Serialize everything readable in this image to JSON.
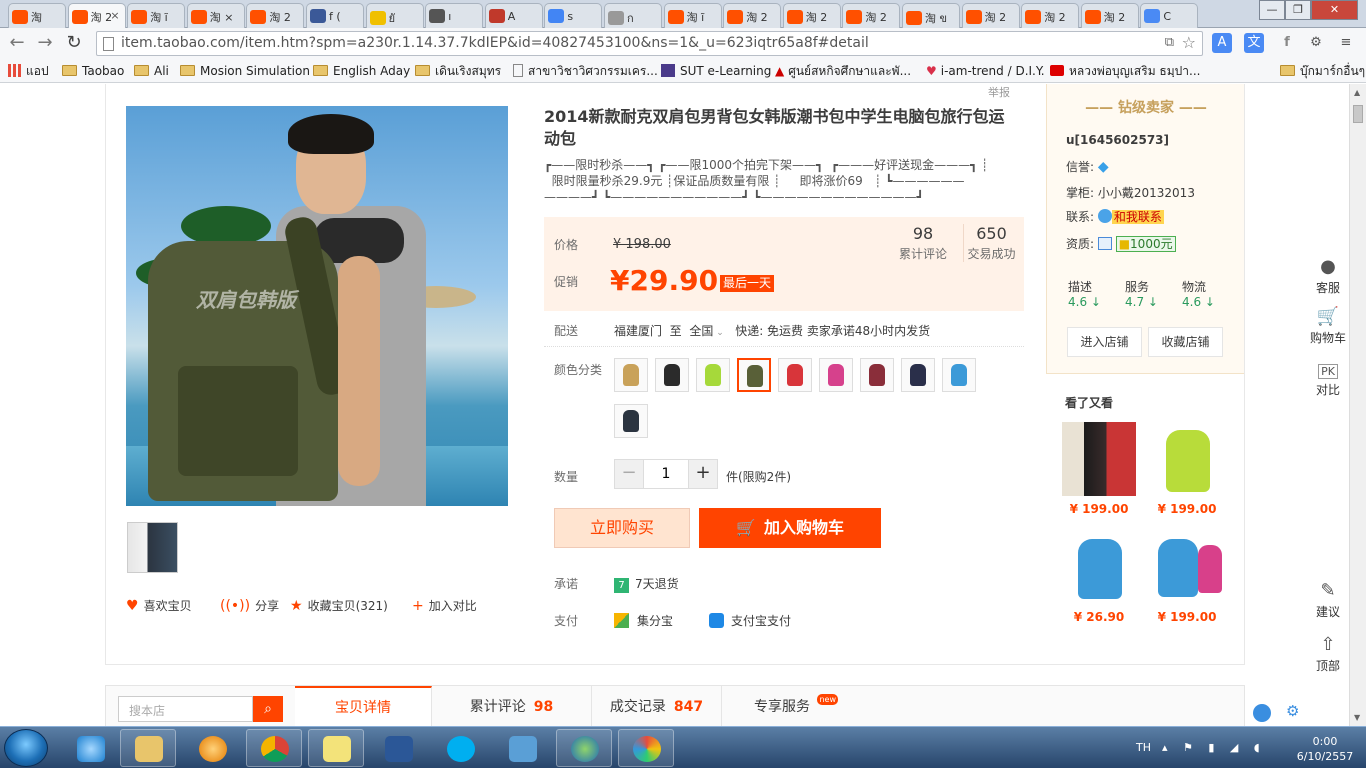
{
  "browser": {
    "tabs": [
      {
        "label": "淘",
        "fav": "taobao-icon",
        "color": "#ff5000"
      },
      {
        "label": "淘 2",
        "fav": "taobao-icon",
        "color": "#ff5000",
        "active": true
      },
      {
        "label": "淘 ĩ",
        "fav": "taobao-icon",
        "color": "#ff5000"
      },
      {
        "label": "淘 ×",
        "fav": "taobao-icon",
        "color": "#ff5000"
      },
      {
        "label": "淘 2",
        "fav": "taobao-icon",
        "color": "#ff5000"
      },
      {
        "label": "f (",
        "fav": "facebook-icon",
        "color": "#3b5998"
      },
      {
        "label": "ยั",
        "fav": "smiley-icon",
        "color": "#f0c000"
      },
      {
        "label": "ı",
        "fav": "generic-icon",
        "color": "#555555"
      },
      {
        "label": "A",
        "fav": "generic-icon",
        "color": "#c0392b"
      },
      {
        "label": "s",
        "fav": "google-icon",
        "color": "#4285f4"
      },
      {
        "label": "ก",
        "fav": "page-icon",
        "color": "#999999"
      },
      {
        "label": "淘 ĩ",
        "fav": "taobao-icon",
        "color": "#ff5000"
      },
      {
        "label": "淘 2",
        "fav": "taobao-icon",
        "color": "#ff5000"
      },
      {
        "label": "淘 2",
        "fav": "taobao-icon",
        "color": "#ff5000"
      },
      {
        "label": "淘 2",
        "fav": "taobao-icon",
        "color": "#ff5000"
      },
      {
        "label": "淘 ข",
        "fav": "taobao-icon",
        "color": "#ff5000"
      },
      {
        "label": "淘 2",
        "fav": "taobao-icon",
        "color": "#ff5000"
      },
      {
        "label": "淘 2",
        "fav": "taobao-icon",
        "color": "#ff5000"
      },
      {
        "label": "淘 2",
        "fav": "taobao-icon",
        "color": "#ff5000"
      },
      {
        "label": "C",
        "fav": "translate-icon",
        "color": "#4a8af4"
      }
    ],
    "url": "item.taobao.com/item.htm?spm=a230r.1.14.37.7kdIEP&id=40827453100&ns=1&_u=623iqtr65a8f#detail",
    "bookmarks": [
      "แอป",
      "Taobao",
      "Ali",
      "Mosion Simulation",
      "English Aday",
      "เดินเริงสมุทร",
      "สาขาวิชาวิศวกรรมเคร...",
      "SUT e-Learning",
      "ศูนย์สหกิจศึกษาและพั...",
      "i-am-trend / D.I.Y.",
      "หลวงพ่อบุญเสริม ธมฺปา...",
      "บุ๊กมาร์กอื่นๆ"
    ]
  },
  "product": {
    "report": "举报",
    "title": "2014新款耐克双肩包男背包女韩版潮书包中学生电脑包旅行包运动包",
    "promo": "┏——限时秒杀——┓ ┏——限1000个拍完下架——┓  ┏———好评送现金———┓ ┊\n  限时限量秒杀29.9元 ┊保证品质数量有限 ┊     即将涨价69   ┊ ┗——————\n————┛ ┗———————————┛ ┗—————————————┛",
    "watermark": "双肩包韩版",
    "price_label": "价格",
    "original_price": "¥ 198.00",
    "promo_label": "促销",
    "price": "¥29.90",
    "price_badge": "最后一天",
    "reviews_count": "98",
    "reviews_label": "累计评论",
    "trades_count": "650",
    "trades_label": "交易成功",
    "ship_label": "配送",
    "ship_from": "福建厦门",
    "ship_to_word": "至",
    "ship_to": "全国",
    "ship_info": "快递: 免运费  卖家承诺48小时内发货",
    "color_label": "颜色分类",
    "qty_label": "数量",
    "qty_value": "1",
    "qty_limit": "件(限购2件)",
    "buy_now": "立即购买",
    "add_cart": "加入购物车",
    "promise_label": "承诺",
    "promise_value": "7天退货",
    "pay_label": "支付",
    "pay_1": "集分宝",
    "pay_2": "支付宝支付",
    "like": "喜欢宝贝",
    "share": "分享",
    "collect": "收藏宝贝(321)",
    "compare": "加入对比"
  },
  "seller": {
    "header": "钻级卖家",
    "name": "u[1645602573]",
    "credit_label": "信誉:",
    "keeper_label": "掌柜:",
    "keeper": "小小戴20132013",
    "contact_label": "联系:",
    "contact": "和我联系",
    "qual_label": "资质:",
    "deposit": "1000元",
    "desc_label": "描述",
    "desc_score": "4.6",
    "service_label": "服务",
    "service_score": "4.7",
    "logistics_label": "物流",
    "logistics_score": "4.6",
    "enter_shop": "进入店铺",
    "fav_shop": "收藏店铺",
    "see_also": "看了又看",
    "recs": [
      "¥ 199.00",
      "¥ 199.00",
      "¥ 26.90",
      "¥ 199.00"
    ]
  },
  "sidebar": {
    "service": "客服",
    "cart": "购物车",
    "compare": "对比",
    "pk": "PK",
    "suggest": "建议",
    "top": "顶部"
  },
  "detail_tabs": {
    "search_placeholder": "搜本店",
    "tab1": "宝贝详情",
    "tab2": "累计评论",
    "tab2_count": "98",
    "tab3": "成交记录",
    "tab3_count": "847",
    "tab4": "专享服务",
    "tab4_badge": "new"
  },
  "taskbar": {
    "lang": "TH",
    "time": "0:00",
    "date": "6/10/2557"
  }
}
